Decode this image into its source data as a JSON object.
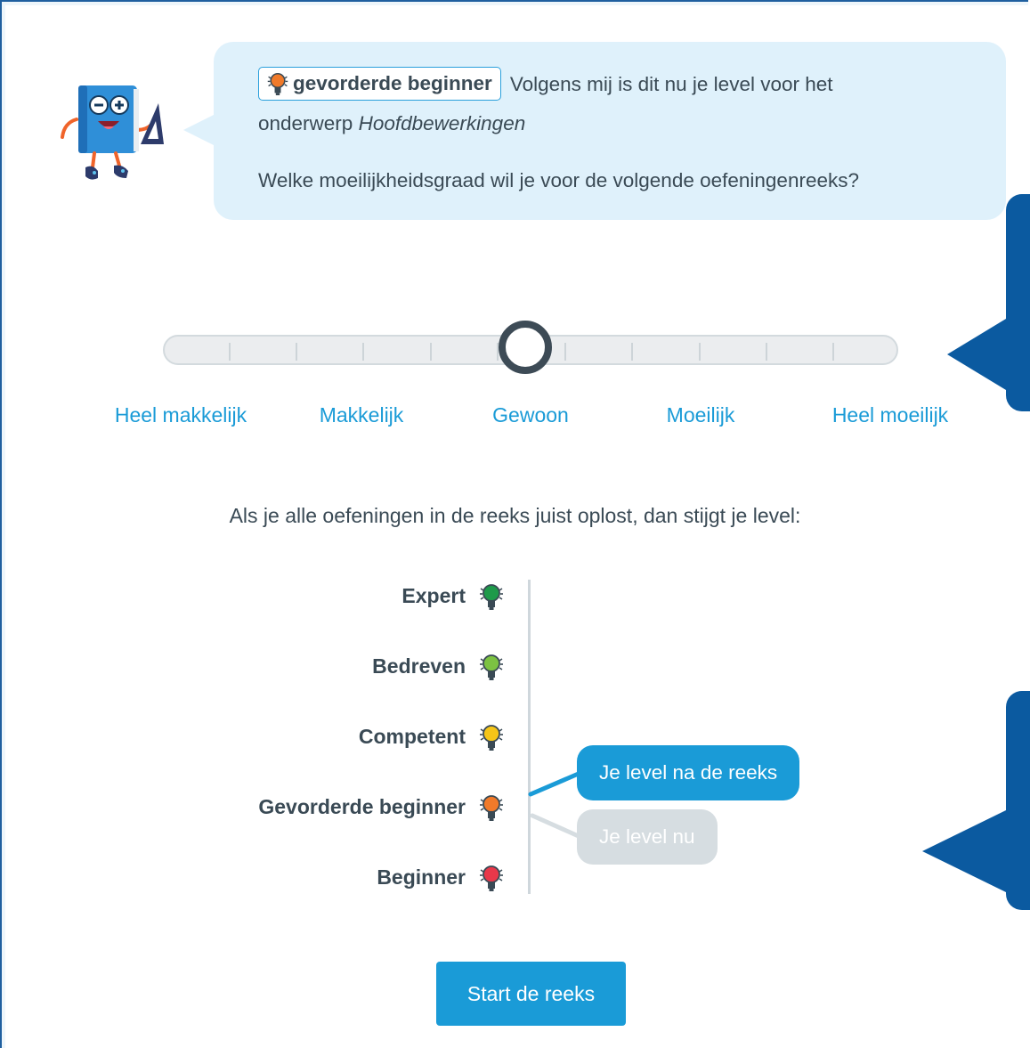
{
  "bubble": {
    "current_level_chip": "gevorderde beginner",
    "message_line1": "Volgens mij is dit nu je level voor het",
    "message_line2_prefix": "onderwerp",
    "topic": "Hoofdbewerkingen",
    "question": "Welke moeilijkheidsgraad wil je voor de volgende oefeningenreeks?"
  },
  "difficulty": {
    "selected": "Gewoon",
    "selected_fraction": 0.5,
    "labels": [
      "Heel makkelijk",
      "Makkelijk",
      "Gewoon",
      "Moeilijk",
      "Heel moeilijk"
    ]
  },
  "rise_text": "Als je alle oefeningen in de reeks juist oplost, dan stijgt je level:",
  "levels": [
    {
      "label": "Expert",
      "color": "#1e9a4a"
    },
    {
      "label": "Bedreven",
      "color": "#7cc242"
    },
    {
      "label": "Competent",
      "color": "#f5c518"
    },
    {
      "label": "Gevorderde beginner",
      "color": "#f07a2a"
    },
    {
      "label": "Beginner",
      "color": "#e8384a"
    }
  ],
  "level_after": "Je level na de reeks",
  "level_now": "Je level nu",
  "start_button": "Start de reeks",
  "colors": {
    "accent": "#1a9bd7",
    "dark_blue": "#0b5aa0",
    "bubble_bg": "#dff1fb"
  }
}
